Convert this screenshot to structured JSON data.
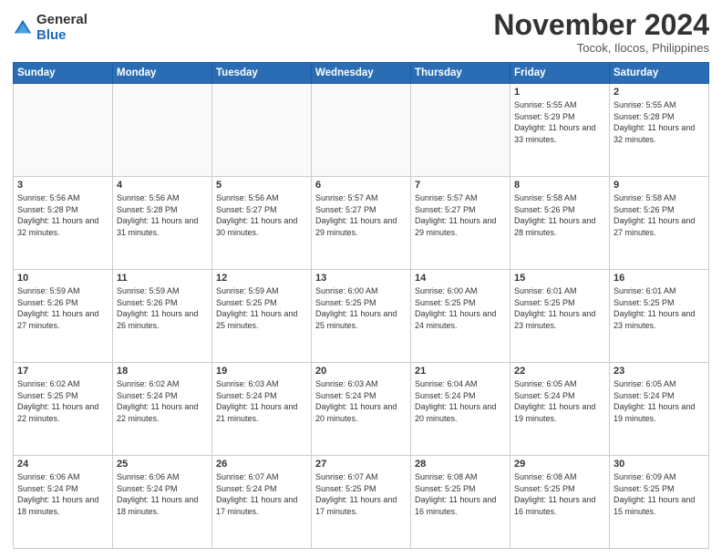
{
  "logo": {
    "general": "General",
    "blue": "Blue"
  },
  "header": {
    "month": "November 2024",
    "location": "Tocok, Ilocos, Philippines"
  },
  "weekdays": [
    "Sunday",
    "Monday",
    "Tuesday",
    "Wednesday",
    "Thursday",
    "Friday",
    "Saturday"
  ],
  "weeks": [
    [
      {
        "day": "",
        "empty": true
      },
      {
        "day": "",
        "empty": true
      },
      {
        "day": "",
        "empty": true
      },
      {
        "day": "",
        "empty": true
      },
      {
        "day": "",
        "empty": true
      },
      {
        "day": "1",
        "sunrise": "5:55 AM",
        "sunset": "5:29 PM",
        "daylight": "11 hours and 33 minutes."
      },
      {
        "day": "2",
        "sunrise": "5:55 AM",
        "sunset": "5:28 PM",
        "daylight": "11 hours and 32 minutes."
      }
    ],
    [
      {
        "day": "3",
        "sunrise": "5:56 AM",
        "sunset": "5:28 PM",
        "daylight": "11 hours and 32 minutes."
      },
      {
        "day": "4",
        "sunrise": "5:56 AM",
        "sunset": "5:28 PM",
        "daylight": "11 hours and 31 minutes."
      },
      {
        "day": "5",
        "sunrise": "5:56 AM",
        "sunset": "5:27 PM",
        "daylight": "11 hours and 30 minutes."
      },
      {
        "day": "6",
        "sunrise": "5:57 AM",
        "sunset": "5:27 PM",
        "daylight": "11 hours and 29 minutes."
      },
      {
        "day": "7",
        "sunrise": "5:57 AM",
        "sunset": "5:27 PM",
        "daylight": "11 hours and 29 minutes."
      },
      {
        "day": "8",
        "sunrise": "5:58 AM",
        "sunset": "5:26 PM",
        "daylight": "11 hours and 28 minutes."
      },
      {
        "day": "9",
        "sunrise": "5:58 AM",
        "sunset": "5:26 PM",
        "daylight": "11 hours and 27 minutes."
      }
    ],
    [
      {
        "day": "10",
        "sunrise": "5:59 AM",
        "sunset": "5:26 PM",
        "daylight": "11 hours and 27 minutes."
      },
      {
        "day": "11",
        "sunrise": "5:59 AM",
        "sunset": "5:26 PM",
        "daylight": "11 hours and 26 minutes."
      },
      {
        "day": "12",
        "sunrise": "5:59 AM",
        "sunset": "5:25 PM",
        "daylight": "11 hours and 25 minutes."
      },
      {
        "day": "13",
        "sunrise": "6:00 AM",
        "sunset": "5:25 PM",
        "daylight": "11 hours and 25 minutes."
      },
      {
        "day": "14",
        "sunrise": "6:00 AM",
        "sunset": "5:25 PM",
        "daylight": "11 hours and 24 minutes."
      },
      {
        "day": "15",
        "sunrise": "6:01 AM",
        "sunset": "5:25 PM",
        "daylight": "11 hours and 23 minutes."
      },
      {
        "day": "16",
        "sunrise": "6:01 AM",
        "sunset": "5:25 PM",
        "daylight": "11 hours and 23 minutes."
      }
    ],
    [
      {
        "day": "17",
        "sunrise": "6:02 AM",
        "sunset": "5:25 PM",
        "daylight": "11 hours and 22 minutes."
      },
      {
        "day": "18",
        "sunrise": "6:02 AM",
        "sunset": "5:24 PM",
        "daylight": "11 hours and 22 minutes."
      },
      {
        "day": "19",
        "sunrise": "6:03 AM",
        "sunset": "5:24 PM",
        "daylight": "11 hours and 21 minutes."
      },
      {
        "day": "20",
        "sunrise": "6:03 AM",
        "sunset": "5:24 PM",
        "daylight": "11 hours and 20 minutes."
      },
      {
        "day": "21",
        "sunrise": "6:04 AM",
        "sunset": "5:24 PM",
        "daylight": "11 hours and 20 minutes."
      },
      {
        "day": "22",
        "sunrise": "6:05 AM",
        "sunset": "5:24 PM",
        "daylight": "11 hours and 19 minutes."
      },
      {
        "day": "23",
        "sunrise": "6:05 AM",
        "sunset": "5:24 PM",
        "daylight": "11 hours and 19 minutes."
      }
    ],
    [
      {
        "day": "24",
        "sunrise": "6:06 AM",
        "sunset": "5:24 PM",
        "daylight": "11 hours and 18 minutes."
      },
      {
        "day": "25",
        "sunrise": "6:06 AM",
        "sunset": "5:24 PM",
        "daylight": "11 hours and 18 minutes."
      },
      {
        "day": "26",
        "sunrise": "6:07 AM",
        "sunset": "5:24 PM",
        "daylight": "11 hours and 17 minutes."
      },
      {
        "day": "27",
        "sunrise": "6:07 AM",
        "sunset": "5:25 PM",
        "daylight": "11 hours and 17 minutes."
      },
      {
        "day": "28",
        "sunrise": "6:08 AM",
        "sunset": "5:25 PM",
        "daylight": "11 hours and 16 minutes."
      },
      {
        "day": "29",
        "sunrise": "6:08 AM",
        "sunset": "5:25 PM",
        "daylight": "11 hours and 16 minutes."
      },
      {
        "day": "30",
        "sunrise": "6:09 AM",
        "sunset": "5:25 PM",
        "daylight": "11 hours and 15 minutes."
      }
    ]
  ]
}
